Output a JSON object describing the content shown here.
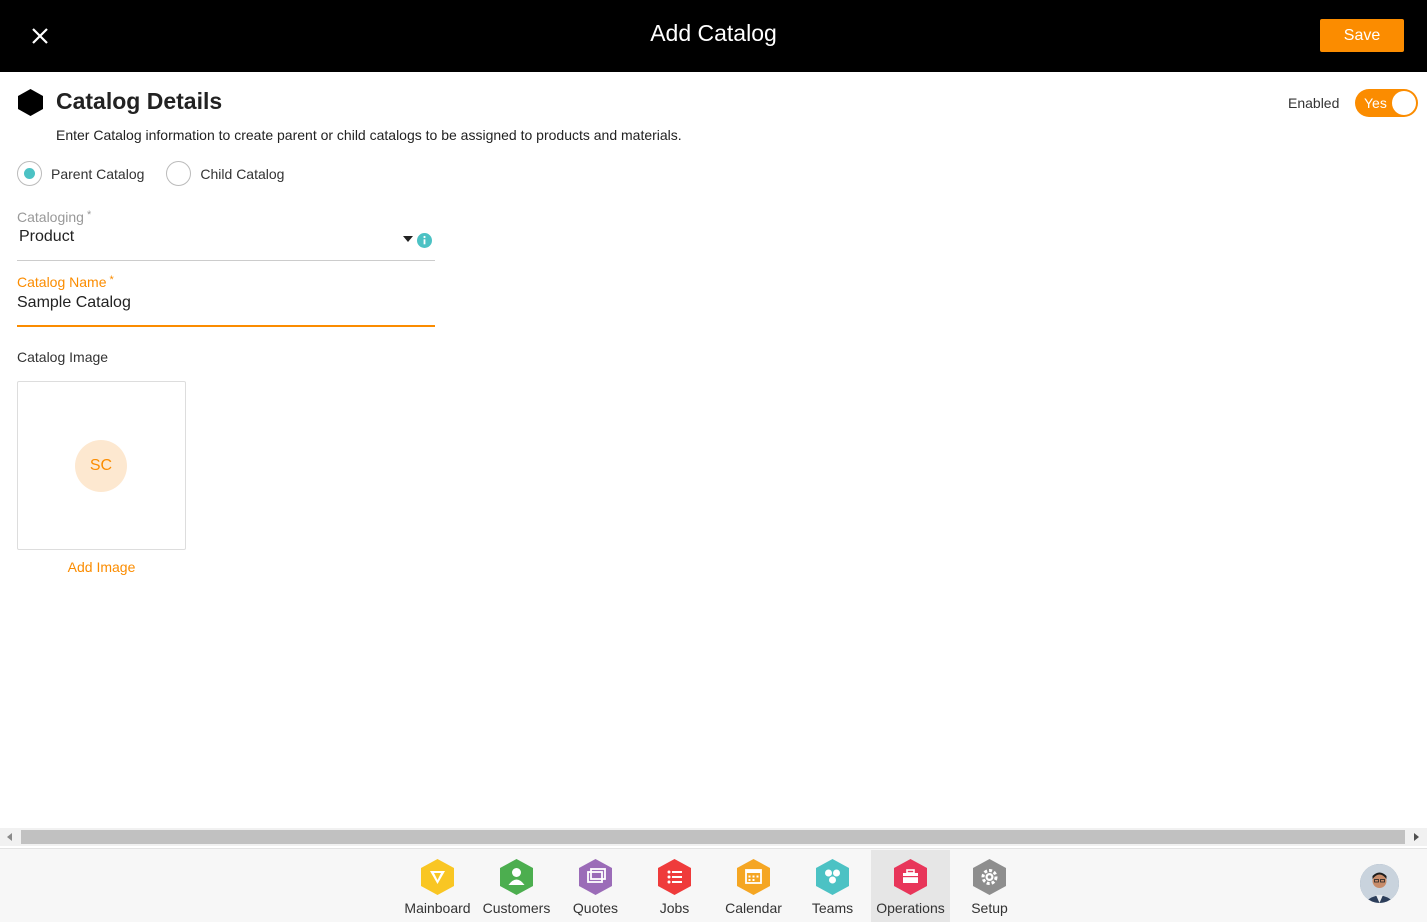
{
  "header": {
    "title": "Add Catalog",
    "save_label": "Save"
  },
  "section": {
    "title": "Catalog Details",
    "description": "Enter Catalog information to create parent or child catalogs to be assigned to products and materials.",
    "enabled_label": "Enabled",
    "enabled_value": "Yes"
  },
  "catalog_type": {
    "options": [
      "Parent Catalog",
      "Child Catalog"
    ],
    "selected": "Parent Catalog"
  },
  "fields": {
    "cataloging": {
      "label": "Cataloging",
      "required": "*",
      "value": "Product"
    },
    "catalog_name": {
      "label": "Catalog Name",
      "required": "*",
      "value": "Sample Catalog"
    },
    "catalog_image": {
      "label": "Catalog Image",
      "initials": "SC",
      "add_label": "Add Image"
    }
  },
  "bottom_nav": {
    "items": [
      {
        "label": "Mainboard",
        "icon": "mainboard-icon",
        "color": "#f9c623"
      },
      {
        "label": "Customers",
        "icon": "customers-icon",
        "color": "#4cae4f"
      },
      {
        "label": "Quotes",
        "icon": "quotes-icon",
        "color": "#9b6cb8"
      },
      {
        "label": "Jobs",
        "icon": "jobs-icon",
        "color": "#ef3b3b"
      },
      {
        "label": "Calendar",
        "icon": "calendar-icon",
        "color": "#f5a623"
      },
      {
        "label": "Teams",
        "icon": "teams-icon",
        "color": "#4cc2c4"
      },
      {
        "label": "Operations",
        "icon": "operations-icon",
        "color": "#e8365a"
      },
      {
        "label": "Setup",
        "icon": "setup-icon",
        "color": "#8e8e8e"
      }
    ],
    "active": "Operations"
  },
  "colors": {
    "accent": "#fb8c00",
    "radio": "#4cc2c4",
    "header_bg": "#000000"
  }
}
